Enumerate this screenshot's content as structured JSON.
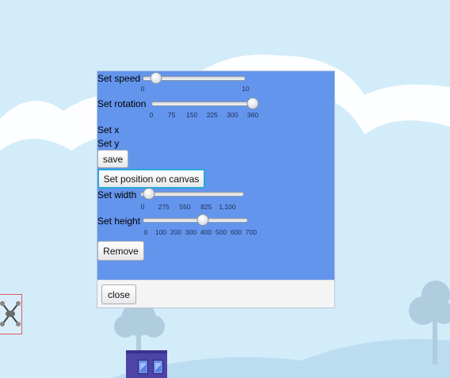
{
  "panel": {
    "speed": {
      "label": "Set speed",
      "min": 0,
      "max": 10,
      "value": 1.3,
      "ticks": [
        "0",
        "10"
      ]
    },
    "rotation": {
      "label": "Set rotation",
      "min": 0,
      "max": 360,
      "value": 360,
      "ticks": [
        "0",
        "75",
        "150",
        "225",
        "300",
        "360"
      ]
    },
    "set_x_label": "Set x",
    "set_y_label": "Set y",
    "save_label": "save",
    "set_position_label": "Set position on canvas",
    "width": {
      "label": "Set width",
      "min": 0,
      "max": 1100,
      "value": 90,
      "ticks": [
        "0",
        "275",
        "550",
        "825",
        "1,100"
      ]
    },
    "height": {
      "label": "Set height",
      "min": 0,
      "max": 700,
      "value": 400,
      "ticks": [
        "0",
        "100",
        "200",
        "300",
        "400",
        "500",
        "600",
        "700"
      ]
    },
    "remove_label": "Remove",
    "close_label": "close"
  },
  "colors": {
    "panel_bg": "#6495ed",
    "sky": "#d3ecfa",
    "cloud": "#ffffff",
    "ground": "#bcdcf0",
    "focus": "#2aa7d8"
  },
  "icons": {
    "drone": "drone-icon",
    "building": "building-icon"
  }
}
